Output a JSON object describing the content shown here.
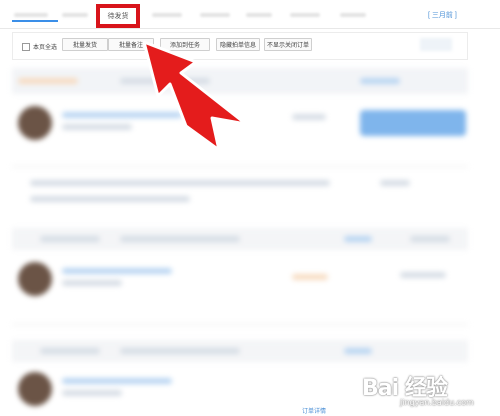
{
  "tabs": {
    "pending_shipment": "待发货",
    "period_link": "[ 三月前 ]"
  },
  "toolbar": {
    "select_page_label": "本页全选",
    "buttons": [
      "批量发货",
      "批量备注",
      "添加到任务",
      "隐藏拍单信息",
      "不显示关闭订单"
    ]
  },
  "footer": {
    "order_detail_link": "订单详情"
  },
  "watermark": {
    "brand": "Bai 经验",
    "url": "jingyan.baidu.com"
  },
  "colors": {
    "accent_blue": "#3b8fe8",
    "highlight_red": "#d8141b"
  }
}
